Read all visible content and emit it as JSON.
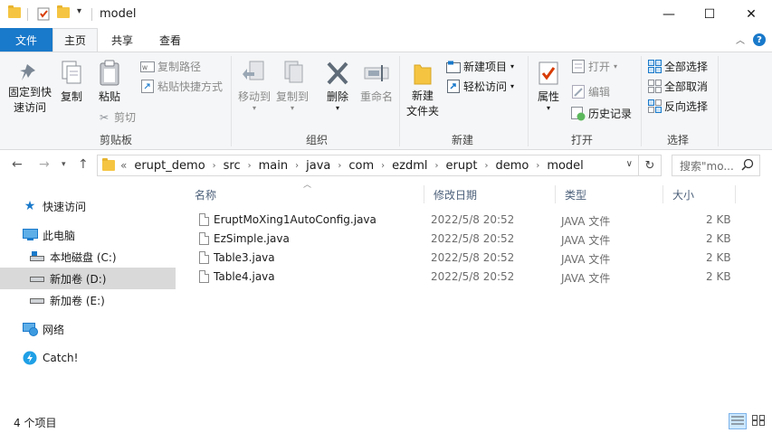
{
  "window": {
    "title": "model",
    "minimize": "—",
    "maximize": "☐",
    "close": "✕"
  },
  "tabs": {
    "file": "文件",
    "home": "主页",
    "share": "共享",
    "view": "查看"
  },
  "ribbon": {
    "clipboard": {
      "group_label": "剪贴板",
      "pin_quick_access": [
        "固定到快",
        "速访问"
      ],
      "copy": "复制",
      "paste": "粘贴",
      "copy_path": "复制路径",
      "paste_shortcut": "粘贴快捷方式",
      "cut": "剪切"
    },
    "organize": {
      "group_label": "组织",
      "move_to": "移动到",
      "copy_to": "复制到",
      "delete": "删除",
      "rename": "重命名"
    },
    "new": {
      "group_label": "新建",
      "new_folder": [
        "新建",
        "文件夹"
      ],
      "new_item": "新建项目",
      "easy_access": "轻松访问"
    },
    "open": {
      "group_label": "打开",
      "properties": "属性",
      "open": "打开",
      "edit": "编辑",
      "history": "历史记录"
    },
    "select": {
      "group_label": "选择",
      "select_all": "全部选择",
      "select_none": "全部取消",
      "invert_selection": "反向选择"
    }
  },
  "address": {
    "overflow": "«",
    "crumbs": [
      "erupt_demo",
      "src",
      "main",
      "java",
      "com",
      "ezdml",
      "erupt",
      "demo",
      "model"
    ],
    "search_placeholder": "搜索\"mo..."
  },
  "nav_pane": {
    "quick_access": "快速访问",
    "this_pc": "此电脑",
    "local_disk_c": "本地磁盘 (C:)",
    "new_volume_d": "新加卷 (D:)",
    "new_volume_e": "新加卷 (E:)",
    "network": "网络",
    "catch": "Catch!"
  },
  "file_list": {
    "columns": {
      "name": "名称",
      "modified": "修改日期",
      "type": "类型",
      "size": "大小"
    },
    "rows": [
      {
        "name": "EruptMoXing1AutoConfig.java",
        "modified": "2022/5/8 20:52",
        "type": "JAVA 文件",
        "size": "2 KB"
      },
      {
        "name": "EzSimple.java",
        "modified": "2022/5/8 20:52",
        "type": "JAVA 文件",
        "size": "2 KB"
      },
      {
        "name": "Table3.java",
        "modified": "2022/5/8 20:52",
        "type": "JAVA 文件",
        "size": "2 KB"
      },
      {
        "name": "Table4.java",
        "modified": "2022/5/8 20:52",
        "type": "JAVA 文件",
        "size": "2 KB"
      }
    ]
  },
  "status": {
    "item_count": "4 个项目"
  },
  "colors": {
    "accent": "#1979ca",
    "folder": "#f5c542",
    "ribbon_bg": "#f5f6f7",
    "selected_nav": "#d9d9d9"
  }
}
